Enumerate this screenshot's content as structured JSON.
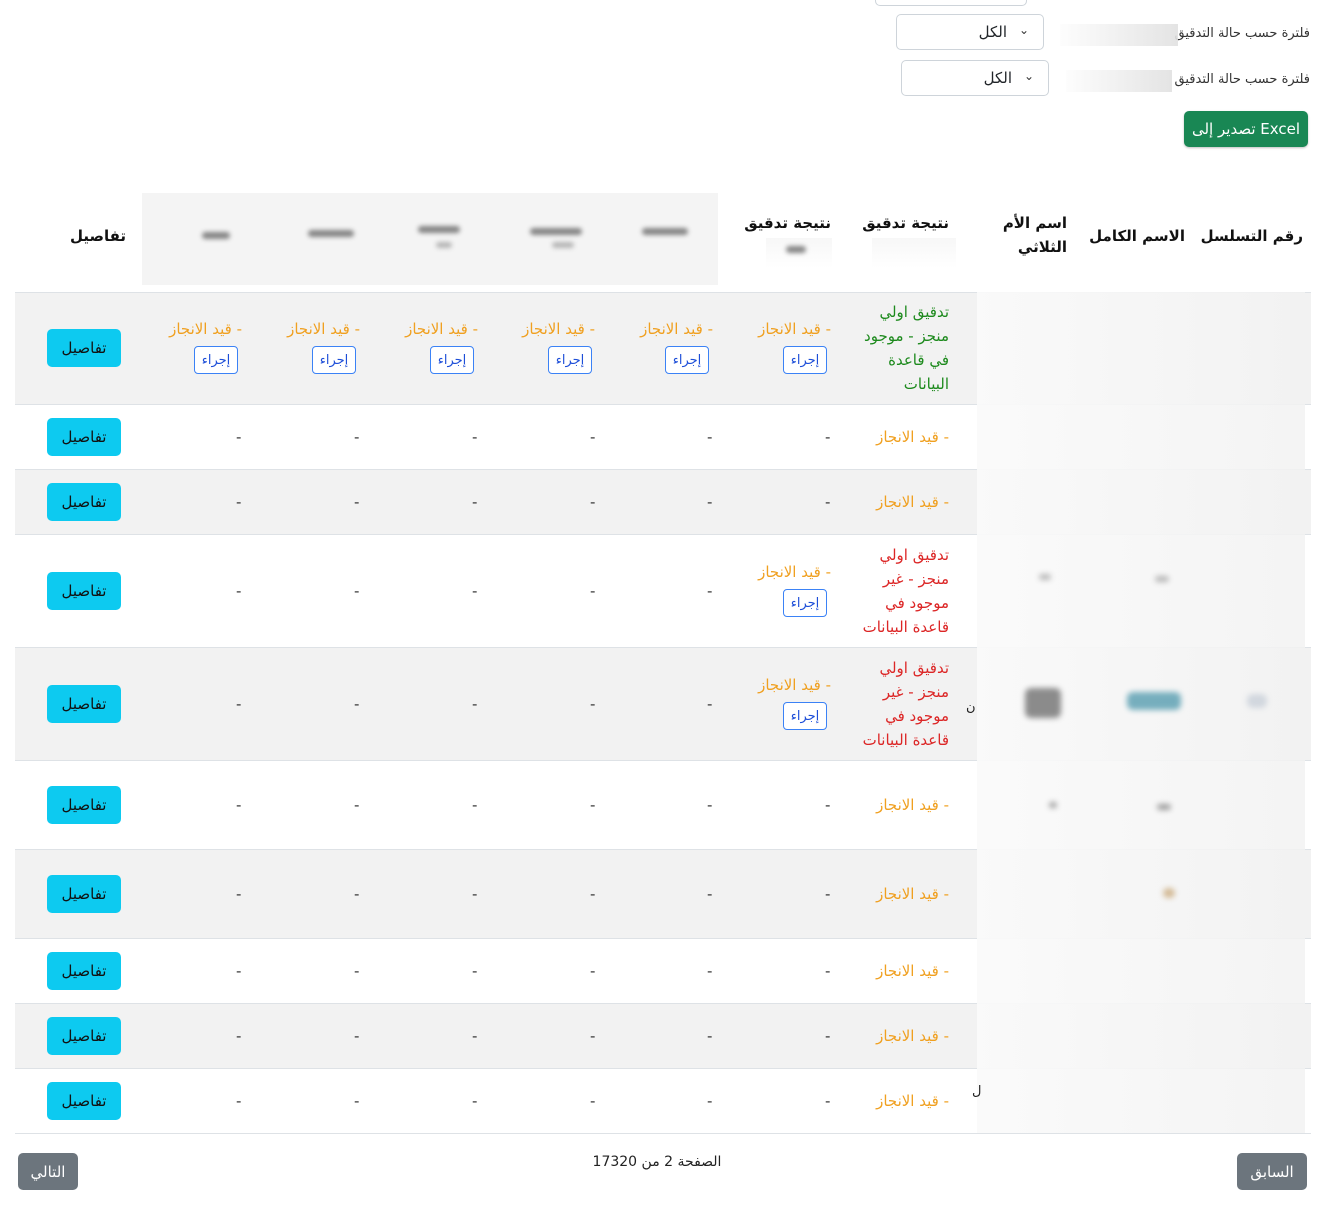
{
  "filters": [
    {
      "label": "فلترة حسب حالة التدقيق",
      "selected": "الكل"
    },
    {
      "label": "فلترة حسب حالة التدقيق",
      "selected": "الكل"
    }
  ],
  "export_label": "تصدير إلى Excel",
  "headers": {
    "serial": "رقم التسلسل",
    "full_name": "الاسم الكامل",
    "mother_name_l1": "اسم الأم",
    "mother_name_l2": "الثلاثي",
    "result1": "نتيجة تدقيق",
    "result2": "نتيجة تدقيق",
    "details": "تفاصيل"
  },
  "statuses": {
    "in_progress": "قيد الانجاز -",
    "found": [
      "تدقيق اولي",
      "منجز - موجود",
      "في قاعدة",
      "البيانات"
    ],
    "not_found": [
      "تدقيق اولي",
      "منجز - غير",
      "موجود في",
      "قاعدة البيانات"
    ]
  },
  "action_label": "إجراء",
  "details_label": "تفاصيل",
  "dash": "-",
  "stray_chars": {
    "row5": "ن",
    "row10": "ل"
  },
  "pagination": {
    "prev": "السابق",
    "next": "التالي",
    "info": "الصفحة 2 من 17320"
  }
}
